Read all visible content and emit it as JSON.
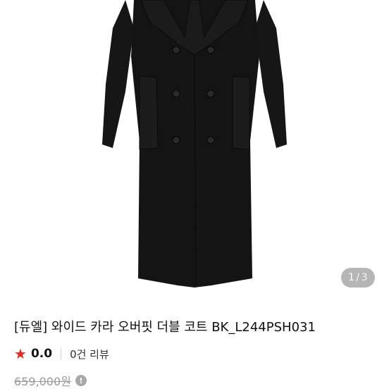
{
  "product": {
    "image_alt": "black double-breasted wide collar overfit coat",
    "title": "[듀엘] 와이드 카라 오버핏 더블 코트 BK_L244PSH031",
    "rating": "0.0",
    "review_count": "0건 리뷰",
    "original_price": "659,000원"
  },
  "gallery": {
    "current": "1",
    "separator": "/",
    "total": "3"
  },
  "icons": {
    "star": "star-icon",
    "info": "info-icon"
  },
  "colors": {
    "star": "#e8261e",
    "coat": "#141414",
    "strike_price": "#9a9a9a"
  }
}
